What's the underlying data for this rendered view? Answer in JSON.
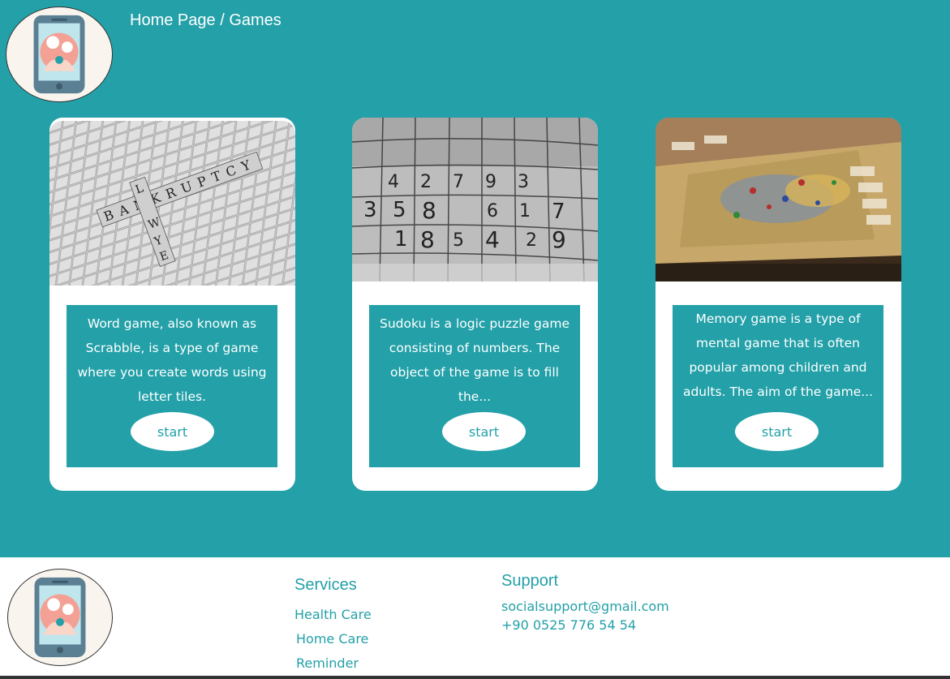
{
  "breadcrumb": {
    "home": "Home Page",
    "separator": "/",
    "current": "Games"
  },
  "logo": {
    "icon": "phone-mother-child-icon"
  },
  "cards": [
    {
      "image": "scrabble-board-photo",
      "description": "Word game, also known as Scrabble, is a type of game where you create words using letter tiles.",
      "button": "start"
    },
    {
      "image": "sudoku-grid-photo",
      "description": "Sudoku is a logic puzzle game consisting of numbers. The object of the game is to fill the...",
      "button": "start"
    },
    {
      "image": "board-game-photo",
      "description": "Memory game is a type of mental game that is often popular among children and adults. The aim of the game...",
      "button": "start"
    }
  ],
  "footer": {
    "services": {
      "heading": "Services",
      "items": [
        "Health Care",
        "Home Care",
        "Reminder"
      ]
    },
    "support": {
      "heading": "Support",
      "email": "socialsupport@gmail.com",
      "phone": "+90 0525 776 54 54"
    }
  },
  "colors": {
    "primary": "#23a0a8",
    "white": "#ffffff"
  }
}
